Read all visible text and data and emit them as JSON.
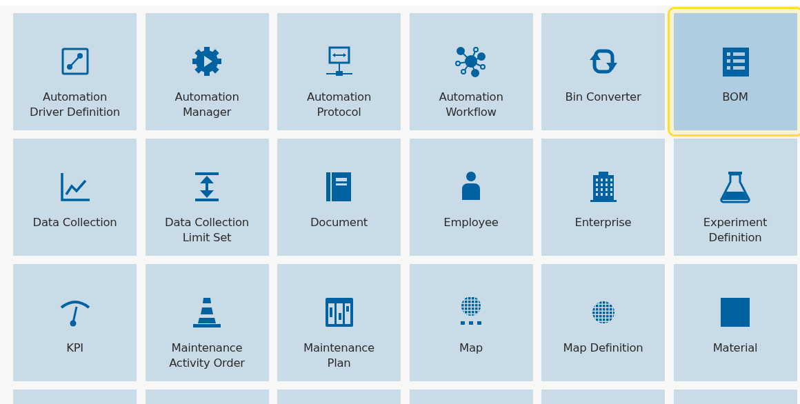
{
  "tiles": [
    {
      "label": "Automation\nDriver Definition",
      "selected": false
    },
    {
      "label": "Automation\nManager",
      "selected": false
    },
    {
      "label": "Automation\nProtocol",
      "selected": false
    },
    {
      "label": "Automation\nWorkflow",
      "selected": false
    },
    {
      "label": "Bin Converter",
      "selected": false
    },
    {
      "label": "BOM",
      "selected": true
    },
    {
      "label": "Data Collection",
      "selected": false
    },
    {
      "label": "Data Collection\nLimit Set",
      "selected": false
    },
    {
      "label": "Document",
      "selected": false
    },
    {
      "label": "Employee",
      "selected": false
    },
    {
      "label": "Enterprise",
      "selected": false
    },
    {
      "label": "Experiment\nDefinition",
      "selected": false
    },
    {
      "label": "KPI",
      "selected": false
    },
    {
      "label": "Maintenance\nActivity Order",
      "selected": false
    },
    {
      "label": "Maintenance\nPlan",
      "selected": false
    },
    {
      "label": "Map",
      "selected": false
    },
    {
      "label": "Map Definition",
      "selected": false
    },
    {
      "label": "Material",
      "selected": false
    }
  ]
}
